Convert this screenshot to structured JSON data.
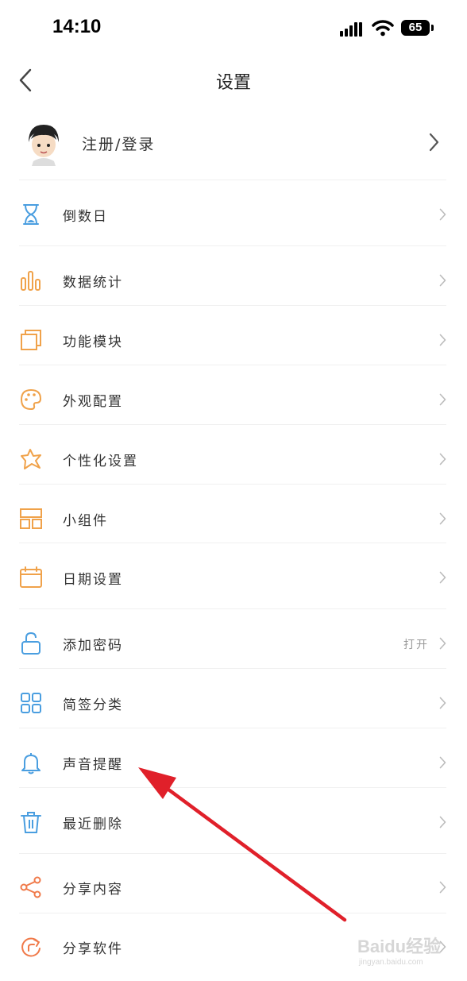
{
  "status_bar": {
    "time": "14:10",
    "battery": "65"
  },
  "header": {
    "title": "设置"
  },
  "profile": {
    "label": "注册/登录"
  },
  "menu": [
    {
      "label": "倒数日",
      "icon": "hourglass-icon",
      "color": "#4a9ee0"
    },
    {
      "label": "数据统计",
      "icon": "bar-chart-icon",
      "color": "#f0a24a"
    },
    {
      "label": "功能模块",
      "icon": "layers-icon",
      "color": "#f0a24a"
    },
    {
      "label": "外观配置",
      "icon": "palette-icon",
      "color": "#f0a24a"
    },
    {
      "label": "个性化设置",
      "icon": "star-icon",
      "color": "#f0a24a"
    },
    {
      "label": "小组件",
      "icon": "widget-icon",
      "color": "#f0a24a"
    },
    {
      "label": "日期设置",
      "icon": "calendar-icon",
      "color": "#f0a24a"
    },
    {
      "label": "添加密码",
      "icon": "lock-icon",
      "color": "#4a9ee0",
      "value": "打开"
    },
    {
      "label": "简签分类",
      "icon": "grid-icon",
      "color": "#4a9ee0"
    },
    {
      "label": "声音提醒",
      "icon": "bell-icon",
      "color": "#4a9ee0"
    },
    {
      "label": "最近删除",
      "icon": "trash-icon",
      "color": "#4a9ee0"
    },
    {
      "label": "分享内容",
      "icon": "share-icon",
      "color": "#f07a4a"
    },
    {
      "label": "分享软件",
      "icon": "refresh-share-icon",
      "color": "#f07a4a"
    }
  ],
  "annotation": {
    "color": "#e0202a"
  },
  "watermark": {
    "main": "Baidu经验",
    "sub": "jingyan.baidu.com"
  }
}
